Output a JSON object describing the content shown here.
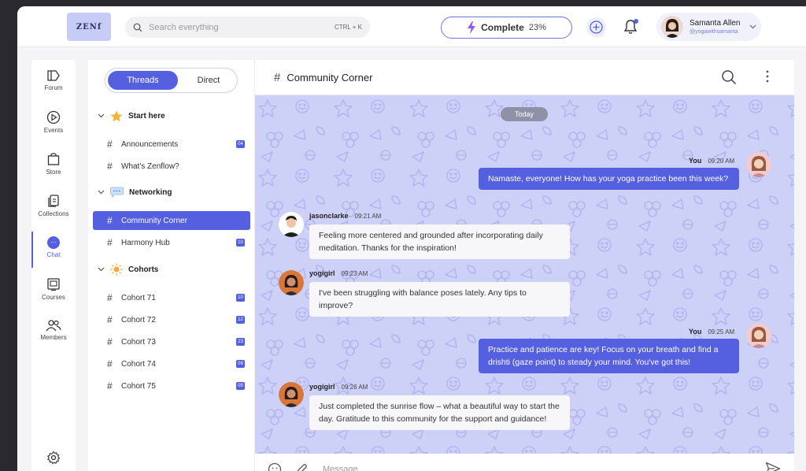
{
  "app": {
    "logo_text": "ZENf"
  },
  "topbar": {
    "search_placeholder": "Search everything",
    "search_shortcut": "CTRL + K",
    "complete_label": "Complete",
    "complete_percent": "23%",
    "user_name": "Samanta Allen",
    "user_handle": "@yogawithsamanta"
  },
  "rail": {
    "items": [
      {
        "label": "Forum",
        "icon": "forum-icon"
      },
      {
        "label": "Events",
        "icon": "events-play-icon"
      },
      {
        "label": "Store",
        "icon": "store-bag-icon"
      },
      {
        "label": "Collections",
        "icon": "collections-icon"
      },
      {
        "label": "Chat",
        "icon": "chat-icon",
        "active": true
      },
      {
        "label": "Courses",
        "icon": "courses-icon"
      },
      {
        "label": "Members",
        "icon": "members-icon"
      }
    ],
    "settings_icon": "gear-icon"
  },
  "channels": {
    "tab_threads": "Threads",
    "tab_direct": "Direct",
    "groups": [
      {
        "name": "Start here",
        "icon": "star-icon",
        "items": [
          {
            "name": "Announcements",
            "badge": "04"
          },
          {
            "name": "What's Zenflow?",
            "badge": ""
          }
        ]
      },
      {
        "name": "Networking",
        "icon": "speech-bubble-icon",
        "items": [
          {
            "name": "Community Corner",
            "badge": "",
            "active": true
          },
          {
            "name": "Harmony Hub",
            "badge": "10"
          }
        ]
      },
      {
        "name": "Cohorts",
        "icon": "sun-icon",
        "items": [
          {
            "name": "Cohort 71",
            "badge": "10"
          },
          {
            "name": "Cohort 72",
            "badge": "12"
          },
          {
            "name": "Cohort 73",
            "badge": "23"
          },
          {
            "name": "Cohort 74",
            "badge": "09"
          },
          {
            "name": "Cohort 75",
            "badge": "09"
          }
        ]
      }
    ]
  },
  "chat": {
    "channel_title": "Community Corner",
    "day_separator": "Today",
    "composer_placeholder": "Message",
    "messages": [
      {
        "author": "You",
        "time": "09:20 AM",
        "outgoing": true,
        "text": "Namaste, everyone! How has your yoga practice been this week?"
      },
      {
        "author": "jasonclarke",
        "time": "09:21 AM",
        "outgoing": false,
        "text": "Feeling more centered and grounded after incorporating daily meditation. Thanks for the inspiration!"
      },
      {
        "author": "yogigirl",
        "time": "09:23 AM",
        "outgoing": false,
        "text": "I've been struggling with balance poses lately. Any tips to improve?"
      },
      {
        "author": "You",
        "time": "09:25 AM",
        "outgoing": true,
        "text": "Practice and patience are key! Focus on your breath and find a drishti (gaze point) to steady your mind. You've got this!"
      },
      {
        "author": "yogigirl",
        "time": "09:26 AM",
        "outgoing": false,
        "text": "Just completed the sunrise flow – what a beautiful way to start the day. Gratitude to this community for the support and guidance!"
      }
    ]
  },
  "colors": {
    "accent": "#5560e0",
    "chat_bg": "#cdd0f7"
  }
}
